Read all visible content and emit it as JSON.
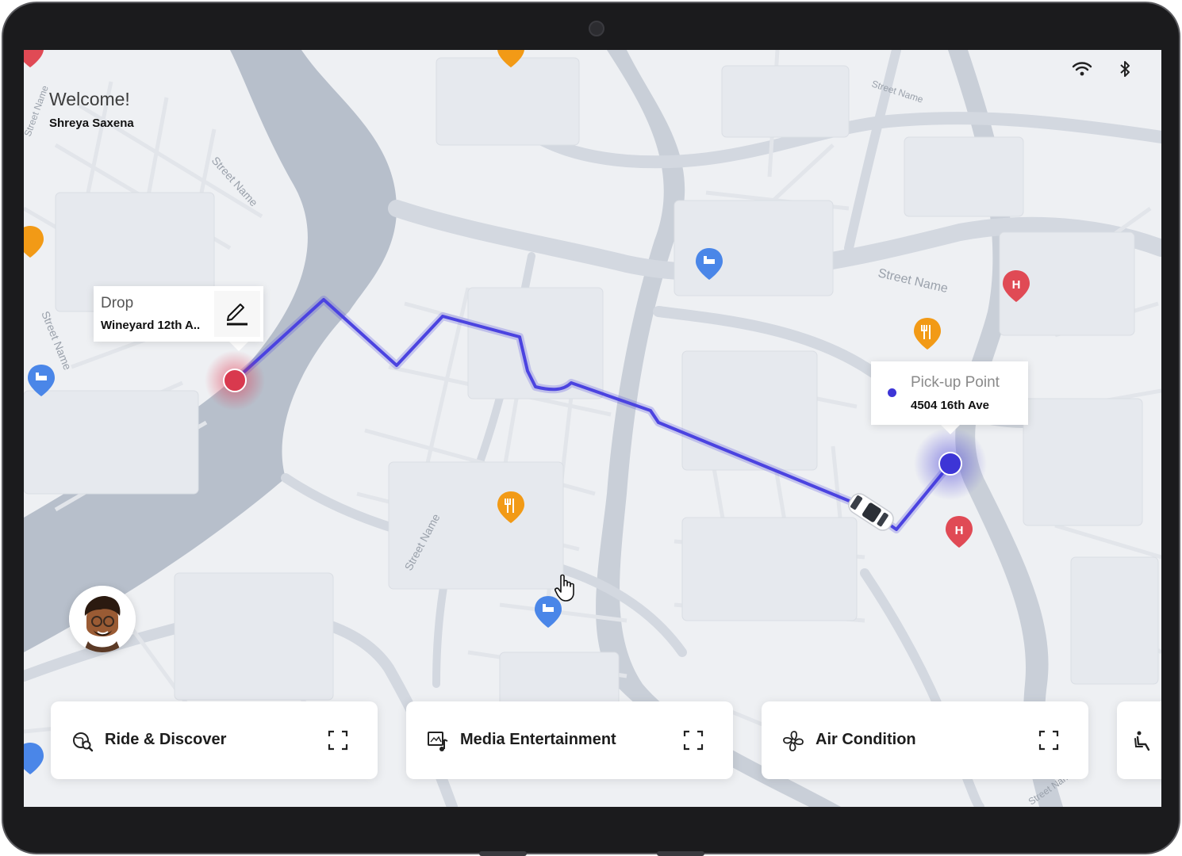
{
  "header": {
    "welcome": "Welcome!",
    "user_name": "Shreya Saxena"
  },
  "status_bar": {
    "icons": [
      "wifi-icon",
      "bluetooth-icon"
    ]
  },
  "map": {
    "street_labels": [
      "Street Name",
      "Street Name",
      "Street Name",
      "Street Name",
      "Street Name",
      "Street Name",
      "Street Name"
    ],
    "route_color": "#4b43e0",
    "drop_marker_color": "#d9394e",
    "pickup_marker_color": "#3d35d6",
    "water_color": "#b7bfcb",
    "road_color": "#d3d8e0"
  },
  "drop": {
    "title": "Drop",
    "address": "Wineyard 12th A.."
  },
  "pickup": {
    "title": "Pick-up Point",
    "address": "4504 16th Ave"
  },
  "pois": {
    "hospital_letter": "H",
    "types": [
      "restaurant-pin",
      "hotel-pin",
      "hospital-pin"
    ]
  },
  "panels": [
    {
      "label": "Ride & Discover",
      "icon": "search-globe-icon"
    },
    {
      "label": "Media Entertainment",
      "icon": "media-music-icon"
    },
    {
      "label": "Air Condition",
      "icon": "fan-icon"
    },
    {
      "label": "",
      "icon": "seat-icon"
    }
  ]
}
